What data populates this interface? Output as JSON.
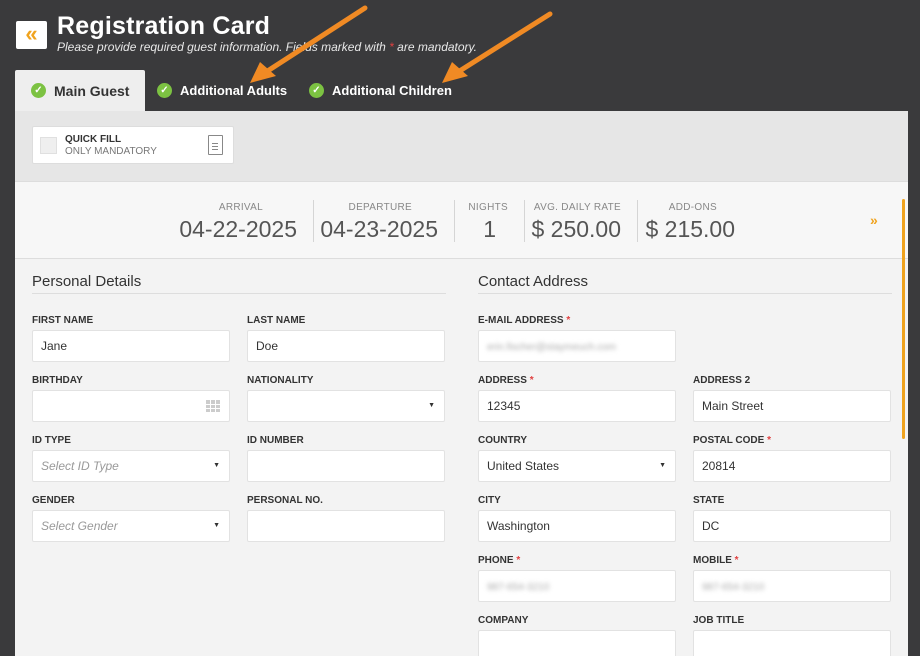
{
  "header": {
    "back_icon": "double-chevron-left-icon",
    "title": "Registration Card",
    "subtitle_before": "Please provide required guest information. Fields marked with ",
    "subtitle_mark": "*",
    "subtitle_after": " are mandatory."
  },
  "tabs": [
    {
      "label": "Main Guest",
      "icon": "check-icon"
    },
    {
      "label": "Additional Adults",
      "icon": "check-icon"
    },
    {
      "label": "Additional Children",
      "icon": "check-icon"
    }
  ],
  "quick_fill": {
    "title": "QUICK FILL",
    "subtitle": "ONLY MANDATORY",
    "icon": "document-icon"
  },
  "summary": {
    "arrival_label": "ARRIVAL",
    "arrival_value": "04-22-2025",
    "departure_label": "DEPARTURE",
    "departure_value": "04-23-2025",
    "nights_label": "NIGHTS",
    "nights_value": "1",
    "rate_label": "AVG. DAILY RATE",
    "rate_value": "$ 250.00",
    "addons_label": "ADD-ONS",
    "addons_value": "$ 215.00",
    "expand_icon": "double-chevron-down-icon"
  },
  "personal": {
    "title": "Personal Details",
    "first_name_label": "FIRST NAME",
    "first_name_value": "Jane",
    "last_name_label": "LAST NAME",
    "last_name_value": "Doe",
    "birthday_label": "BIRTHDAY",
    "birthday_value": "",
    "nationality_label": "NATIONALITY",
    "nationality_value": "",
    "id_type_label": "ID TYPE",
    "id_type_placeholder": "Select ID Type",
    "id_number_label": "ID NUMBER",
    "id_number_value": "",
    "gender_label": "GENDER",
    "gender_placeholder": "Select Gender",
    "personal_no_label": "PERSONAL NO.",
    "personal_no_value": ""
  },
  "contact": {
    "title": "Contact Address",
    "email_label": "E-MAIL ADDRESS",
    "email_value": "erin.fischer@staymeuch.com",
    "address_label": "ADDRESS",
    "address_value": "12345",
    "address2_label": "ADDRESS 2",
    "address2_value": "Main Street",
    "country_label": "COUNTRY",
    "country_value": "United States",
    "postal_label": "POSTAL CODE",
    "postal_value": "20814",
    "city_label": "CITY",
    "city_value": "Washington",
    "state_label": "STATE",
    "state_value": "DC",
    "phone_label": "PHONE",
    "phone_value": "987-654-3210",
    "mobile_label": "MOBILE",
    "mobile_value": "987-654-3210",
    "company_label": "COMPANY",
    "company_value": "",
    "job_title_label": "JOB TITLE",
    "job_title_value": "",
    "required_mark": "*"
  },
  "colors": {
    "accent": "#f0a31e",
    "annotation_arrow": "#f08a24",
    "check": "#7cc242",
    "header_bg": "#3a3a3c"
  }
}
